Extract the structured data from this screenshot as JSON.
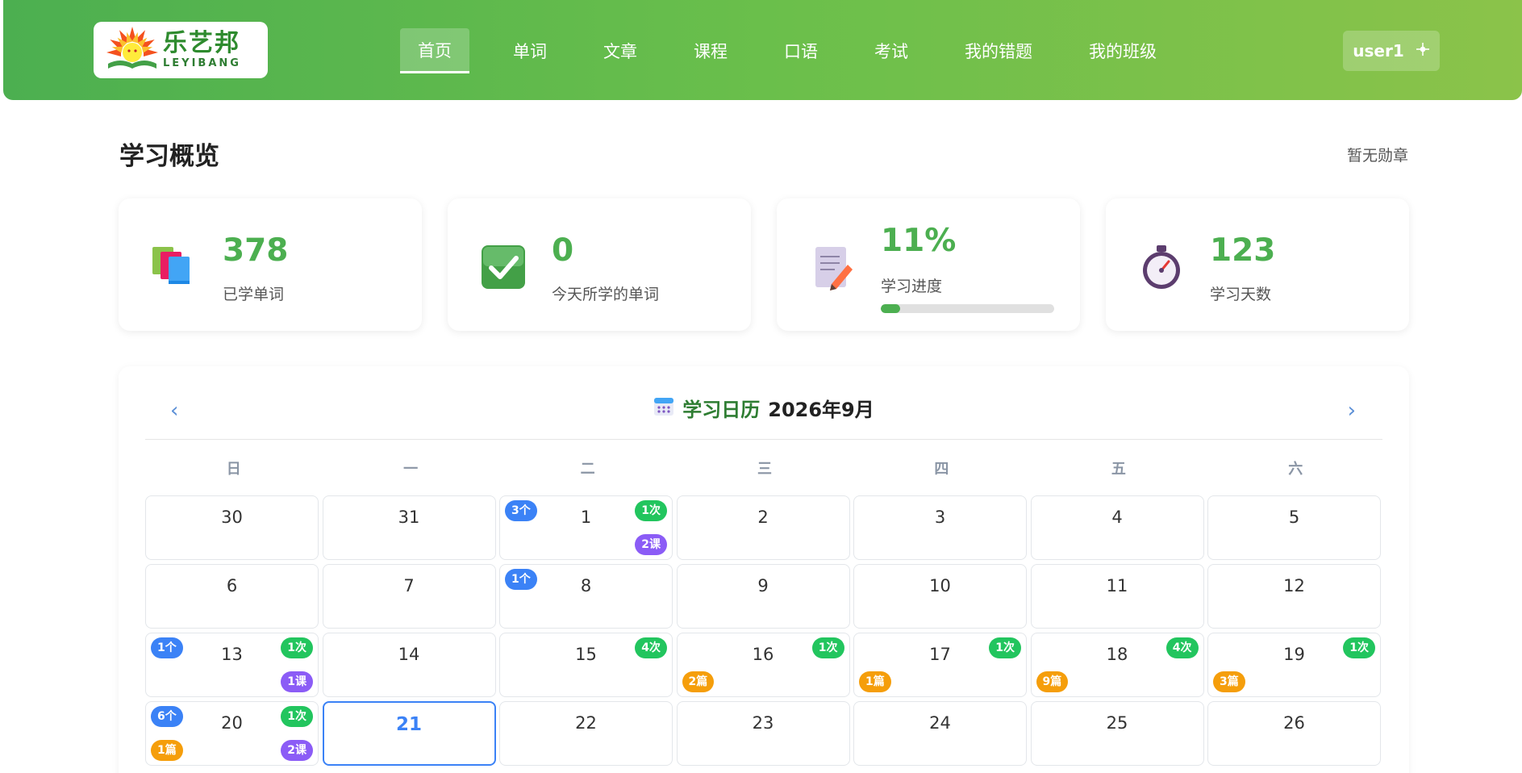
{
  "logo": {
    "cn": "乐艺邦",
    "en": "LEYIBANG"
  },
  "nav": [
    {
      "label": "首页",
      "active": true
    },
    {
      "label": "单词"
    },
    {
      "label": "文章"
    },
    {
      "label": "课程"
    },
    {
      "label": "口语"
    },
    {
      "label": "考试"
    },
    {
      "label": "我的错题"
    },
    {
      "label": "我的班级"
    }
  ],
  "user": {
    "name": "user1"
  },
  "overview": {
    "title": "学习概览",
    "badges": "暂无勋章"
  },
  "stats": [
    {
      "icon": "books-icon",
      "value": "378",
      "label": "已学单词"
    },
    {
      "icon": "checkmark-icon",
      "value": "0",
      "label": "今天所学的单词"
    },
    {
      "icon": "memo-icon",
      "value": "11%",
      "label": "学习进度",
      "progress": 0.11
    },
    {
      "icon": "stopwatch-icon",
      "value": "123",
      "label": "学习天数"
    }
  ],
  "calendar": {
    "title": "学习日历",
    "month": "2026年9月",
    "prev": "‹",
    "next": "›",
    "weekdays": [
      "日",
      "一",
      "二",
      "三",
      "四",
      "五",
      "六"
    ],
    "today": "21",
    "days": [
      {
        "n": "30"
      },
      {
        "n": "31"
      },
      {
        "n": "1",
        "words": "3个",
        "count": "1次",
        "course": "2课"
      },
      {
        "n": "2"
      },
      {
        "n": "3"
      },
      {
        "n": "4"
      },
      {
        "n": "5"
      },
      {
        "n": "6"
      },
      {
        "n": "7"
      },
      {
        "n": "8",
        "words": "1个"
      },
      {
        "n": "9"
      },
      {
        "n": "10"
      },
      {
        "n": "11"
      },
      {
        "n": "12"
      },
      {
        "n": "13",
        "words": "1个",
        "count": "1次",
        "course": "1课"
      },
      {
        "n": "14"
      },
      {
        "n": "15",
        "count": "4次"
      },
      {
        "n": "16",
        "count": "1次",
        "article": "2篇"
      },
      {
        "n": "17",
        "count": "1次",
        "article": "1篇"
      },
      {
        "n": "18",
        "count": "4次",
        "article": "9篇"
      },
      {
        "n": "19",
        "count": "1次",
        "article": "3篇"
      },
      {
        "n": "20",
        "words": "6个",
        "count": "1次",
        "article": "1篇",
        "course": "2课"
      },
      {
        "n": "21"
      },
      {
        "n": "22"
      },
      {
        "n": "23"
      },
      {
        "n": "24"
      },
      {
        "n": "25"
      },
      {
        "n": "26"
      }
    ]
  },
  "colors": {
    "primary": "#4caf50",
    "accent": "#3b82f6",
    "word_tag": "#3b82f6",
    "count_tag": "#22c55e",
    "course_tag": "#8b5cf6",
    "article_tag": "#f59e0b"
  }
}
